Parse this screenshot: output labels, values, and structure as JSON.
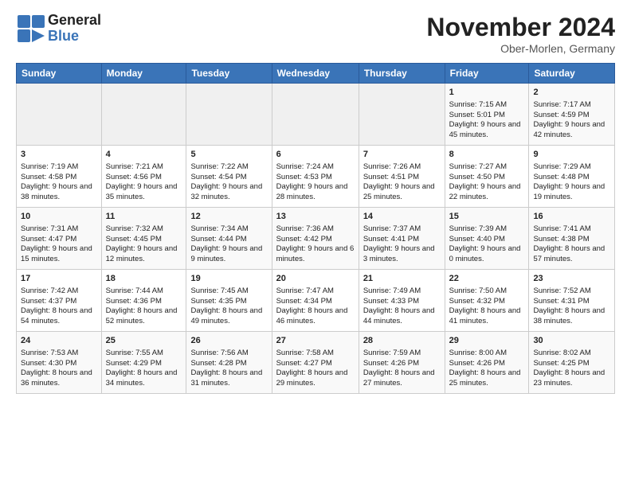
{
  "header": {
    "logo_line1": "General",
    "logo_line2": "Blue",
    "month": "November 2024",
    "location": "Ober-Morlen, Germany"
  },
  "days_of_week": [
    "Sunday",
    "Monday",
    "Tuesday",
    "Wednesday",
    "Thursday",
    "Friday",
    "Saturday"
  ],
  "weeks": [
    [
      {
        "day": "",
        "info": ""
      },
      {
        "day": "",
        "info": ""
      },
      {
        "day": "",
        "info": ""
      },
      {
        "day": "",
        "info": ""
      },
      {
        "day": "",
        "info": ""
      },
      {
        "day": "1",
        "info": "Sunrise: 7:15 AM\nSunset: 5:01 PM\nDaylight: 9 hours and 45 minutes."
      },
      {
        "day": "2",
        "info": "Sunrise: 7:17 AM\nSunset: 4:59 PM\nDaylight: 9 hours and 42 minutes."
      }
    ],
    [
      {
        "day": "3",
        "info": "Sunrise: 7:19 AM\nSunset: 4:58 PM\nDaylight: 9 hours and 38 minutes."
      },
      {
        "day": "4",
        "info": "Sunrise: 7:21 AM\nSunset: 4:56 PM\nDaylight: 9 hours and 35 minutes."
      },
      {
        "day": "5",
        "info": "Sunrise: 7:22 AM\nSunset: 4:54 PM\nDaylight: 9 hours and 32 minutes."
      },
      {
        "day": "6",
        "info": "Sunrise: 7:24 AM\nSunset: 4:53 PM\nDaylight: 9 hours and 28 minutes."
      },
      {
        "day": "7",
        "info": "Sunrise: 7:26 AM\nSunset: 4:51 PM\nDaylight: 9 hours and 25 minutes."
      },
      {
        "day": "8",
        "info": "Sunrise: 7:27 AM\nSunset: 4:50 PM\nDaylight: 9 hours and 22 minutes."
      },
      {
        "day": "9",
        "info": "Sunrise: 7:29 AM\nSunset: 4:48 PM\nDaylight: 9 hours and 19 minutes."
      }
    ],
    [
      {
        "day": "10",
        "info": "Sunrise: 7:31 AM\nSunset: 4:47 PM\nDaylight: 9 hours and 15 minutes."
      },
      {
        "day": "11",
        "info": "Sunrise: 7:32 AM\nSunset: 4:45 PM\nDaylight: 9 hours and 12 minutes."
      },
      {
        "day": "12",
        "info": "Sunrise: 7:34 AM\nSunset: 4:44 PM\nDaylight: 9 hours and 9 minutes."
      },
      {
        "day": "13",
        "info": "Sunrise: 7:36 AM\nSunset: 4:42 PM\nDaylight: 9 hours and 6 minutes."
      },
      {
        "day": "14",
        "info": "Sunrise: 7:37 AM\nSunset: 4:41 PM\nDaylight: 9 hours and 3 minutes."
      },
      {
        "day": "15",
        "info": "Sunrise: 7:39 AM\nSunset: 4:40 PM\nDaylight: 9 hours and 0 minutes."
      },
      {
        "day": "16",
        "info": "Sunrise: 7:41 AM\nSunset: 4:38 PM\nDaylight: 8 hours and 57 minutes."
      }
    ],
    [
      {
        "day": "17",
        "info": "Sunrise: 7:42 AM\nSunset: 4:37 PM\nDaylight: 8 hours and 54 minutes."
      },
      {
        "day": "18",
        "info": "Sunrise: 7:44 AM\nSunset: 4:36 PM\nDaylight: 8 hours and 52 minutes."
      },
      {
        "day": "19",
        "info": "Sunrise: 7:45 AM\nSunset: 4:35 PM\nDaylight: 8 hours and 49 minutes."
      },
      {
        "day": "20",
        "info": "Sunrise: 7:47 AM\nSunset: 4:34 PM\nDaylight: 8 hours and 46 minutes."
      },
      {
        "day": "21",
        "info": "Sunrise: 7:49 AM\nSunset: 4:33 PM\nDaylight: 8 hours and 44 minutes."
      },
      {
        "day": "22",
        "info": "Sunrise: 7:50 AM\nSunset: 4:32 PM\nDaylight: 8 hours and 41 minutes."
      },
      {
        "day": "23",
        "info": "Sunrise: 7:52 AM\nSunset: 4:31 PM\nDaylight: 8 hours and 38 minutes."
      }
    ],
    [
      {
        "day": "24",
        "info": "Sunrise: 7:53 AM\nSunset: 4:30 PM\nDaylight: 8 hours and 36 minutes."
      },
      {
        "day": "25",
        "info": "Sunrise: 7:55 AM\nSunset: 4:29 PM\nDaylight: 8 hours and 34 minutes."
      },
      {
        "day": "26",
        "info": "Sunrise: 7:56 AM\nSunset: 4:28 PM\nDaylight: 8 hours and 31 minutes."
      },
      {
        "day": "27",
        "info": "Sunrise: 7:58 AM\nSunset: 4:27 PM\nDaylight: 8 hours and 29 minutes."
      },
      {
        "day": "28",
        "info": "Sunrise: 7:59 AM\nSunset: 4:26 PM\nDaylight: 8 hours and 27 minutes."
      },
      {
        "day": "29",
        "info": "Sunrise: 8:00 AM\nSunset: 4:26 PM\nDaylight: 8 hours and 25 minutes."
      },
      {
        "day": "30",
        "info": "Sunrise: 8:02 AM\nSunset: 4:25 PM\nDaylight: 8 hours and 23 minutes."
      }
    ]
  ]
}
